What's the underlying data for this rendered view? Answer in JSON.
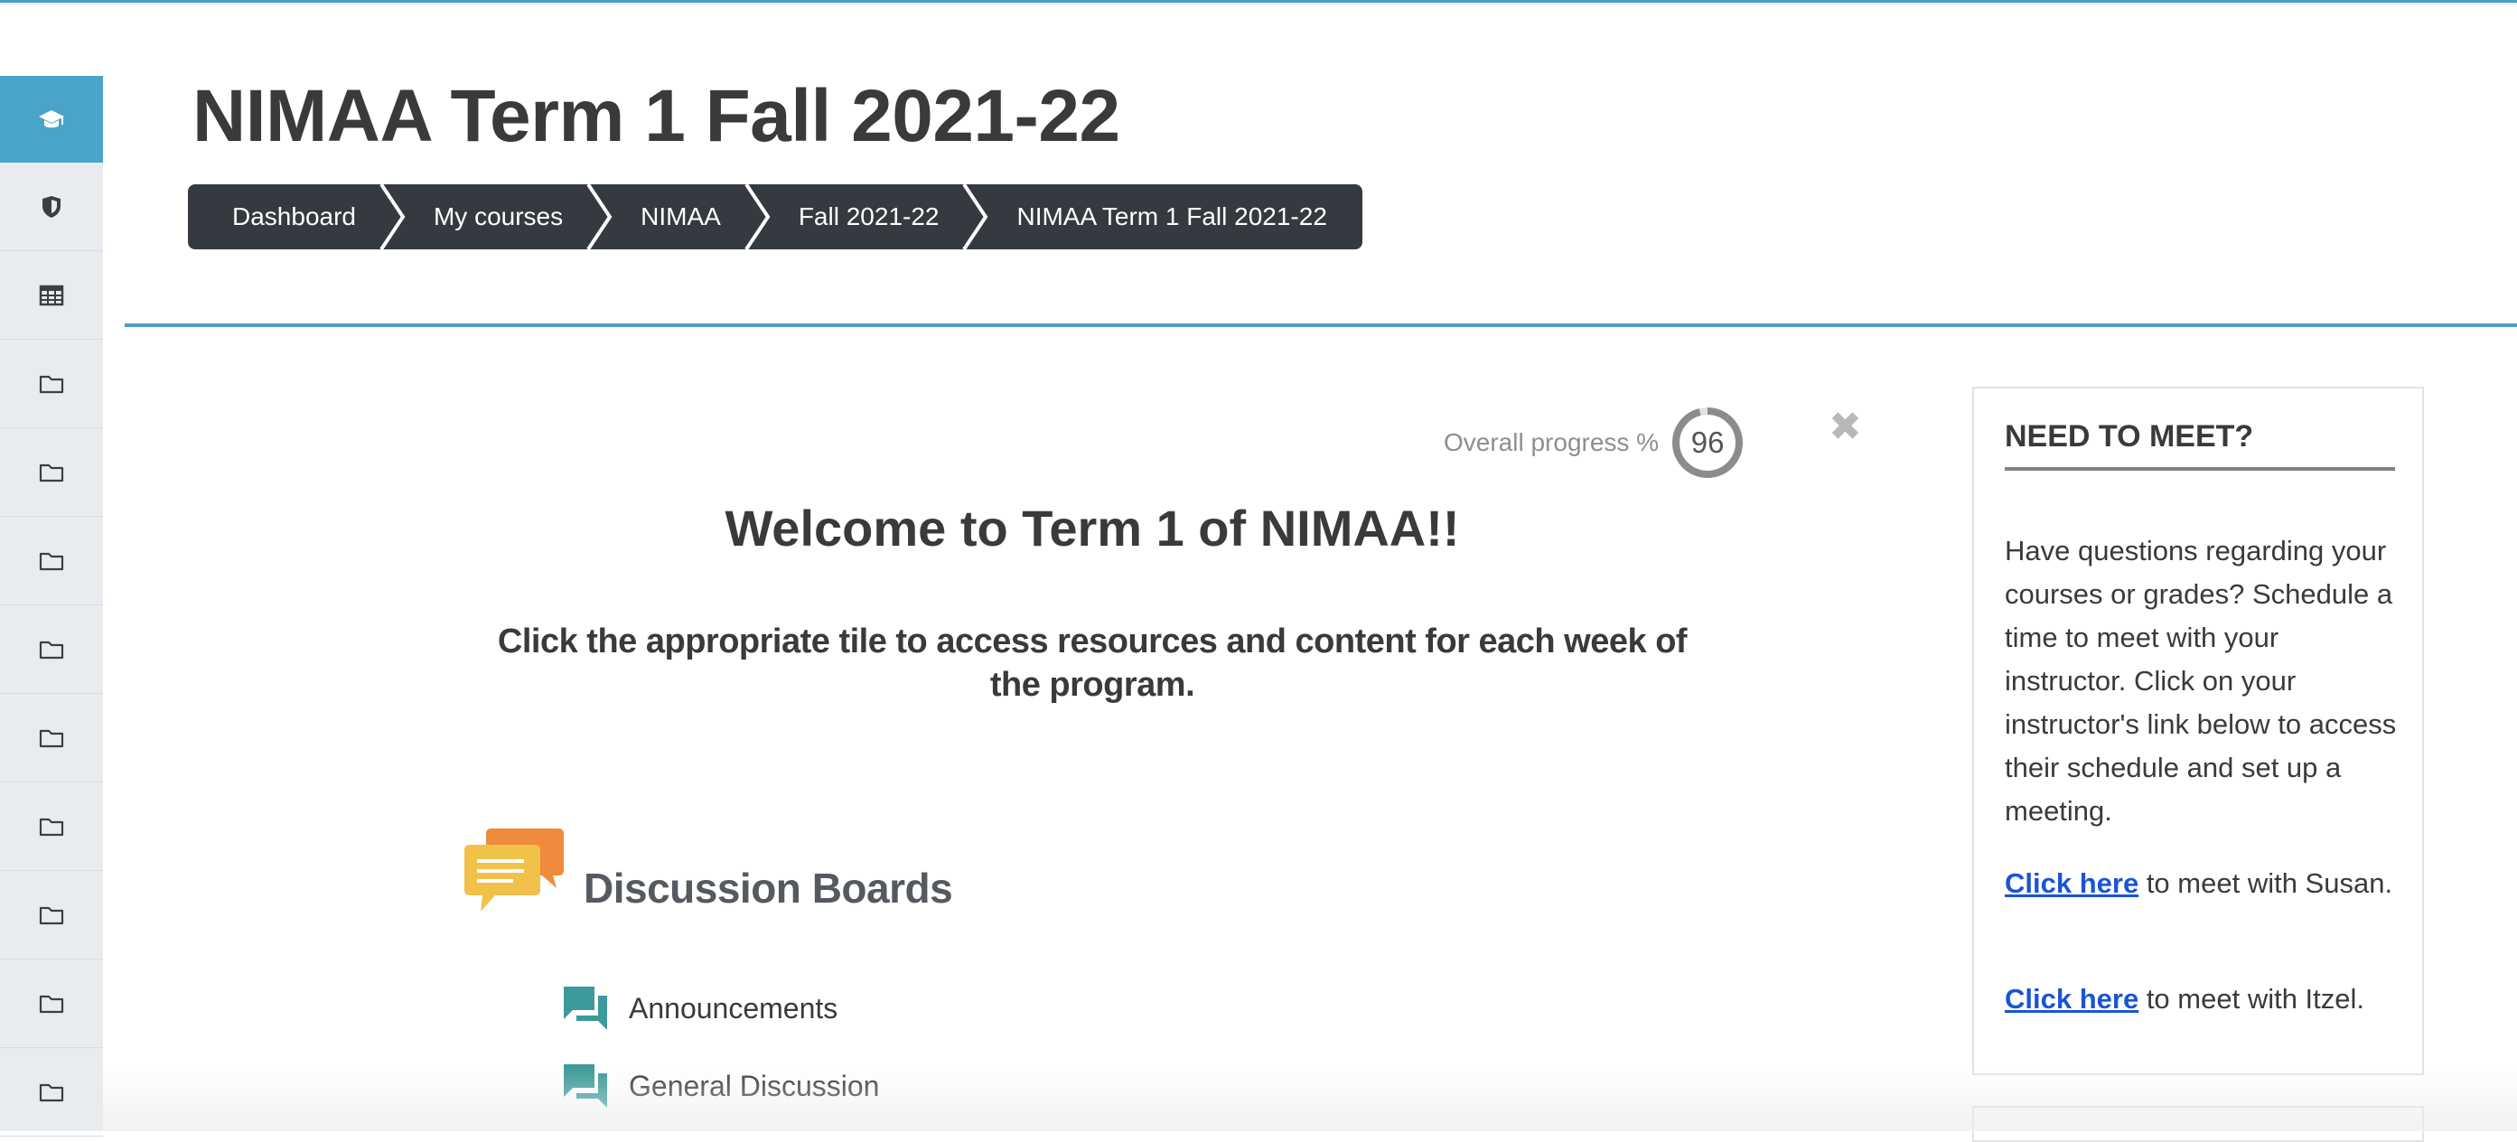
{
  "page": {
    "title": "NIMAA Term 1 Fall 2021-22"
  },
  "breadcrumb": [
    {
      "label": "Dashboard"
    },
    {
      "label": "My courses"
    },
    {
      "label": "NIMAA"
    },
    {
      "label": "Fall 2021-22"
    },
    {
      "label": "NIMAA Term 1 Fall 2021-22"
    }
  ],
  "sidebar": {
    "items": [
      {
        "icon": "graduation-cap-icon",
        "active": true
      },
      {
        "icon": "shield-icon"
      },
      {
        "icon": "table-icon"
      },
      {
        "icon": "folder-icon"
      },
      {
        "icon": "folder-icon"
      },
      {
        "icon": "folder-icon"
      },
      {
        "icon": "folder-icon"
      },
      {
        "icon": "folder-icon"
      },
      {
        "icon": "folder-icon"
      },
      {
        "icon": "folder-icon"
      },
      {
        "icon": "folder-icon"
      },
      {
        "icon": "folder-icon"
      }
    ]
  },
  "progress": {
    "label": "Overall progress %",
    "value": "96",
    "fraction": 0.96
  },
  "main": {
    "welcome": "Welcome to Term 1 of NIMAA!!",
    "subtitle": "Click the appropriate tile to access resources and content for each week of the program.",
    "section_title": "Discussion Boards",
    "activities": [
      {
        "label": "Announcements",
        "icon": "forum-icon"
      },
      {
        "label": "General Discussion",
        "icon": "forum-icon"
      }
    ]
  },
  "block": {
    "title": "NEED TO MEET?",
    "text": "Have questions regarding your courses or grades? Schedule a time to meet with your instructor. Click on your instructor's link below to access their schedule and set up a meeting.",
    "link1_text": "Click here",
    "link1_rest": " to meet with Susan.",
    "link2_text": "Click here",
    "link2_rest": " to meet with Itzel."
  },
  "colors": {
    "accent": "#4a9fc2",
    "breadcrumb_bg": "#353a40",
    "link": "#1a54d6",
    "forum_icon": "#3d9a9a"
  }
}
